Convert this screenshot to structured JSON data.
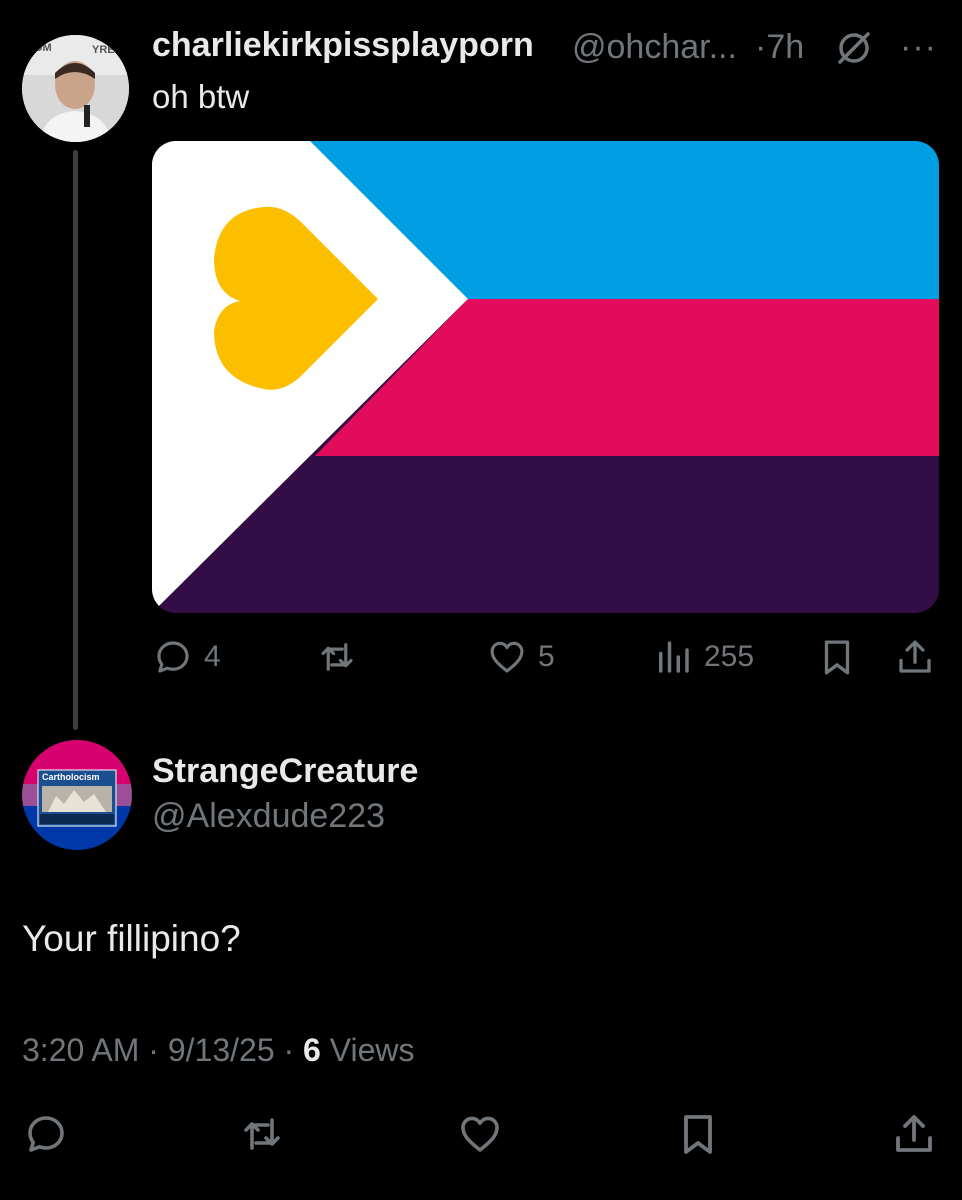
{
  "parent_tweet": {
    "display_name": "charliekirkpissplayporn",
    "handle": "@ohchar...",
    "separator": "·",
    "time": "7h",
    "more_label": "···",
    "text": "oh btw",
    "media_icon": "flag-image",
    "colors": {
      "blue": "#009fe3",
      "pink": "#e30b5c",
      "purple": "#330d45",
      "heart": "#fcbf00"
    },
    "stats": {
      "replies": "4",
      "likes": "5",
      "views": "255"
    }
  },
  "reply_tweet": {
    "display_name": "StrangeCreature",
    "handle": "@Alexdude223",
    "avatar_text": "Cartholocism",
    "text": "Your fillipino?",
    "timestamp": "3:20 AM",
    "date": "9/13/25",
    "views_count": "6",
    "views_label": "Views",
    "separator": "·"
  },
  "action_bar": {
    "icons": [
      "reply-icon",
      "repost-icon",
      "like-icon",
      "bookmark-icon",
      "share-icon"
    ]
  }
}
